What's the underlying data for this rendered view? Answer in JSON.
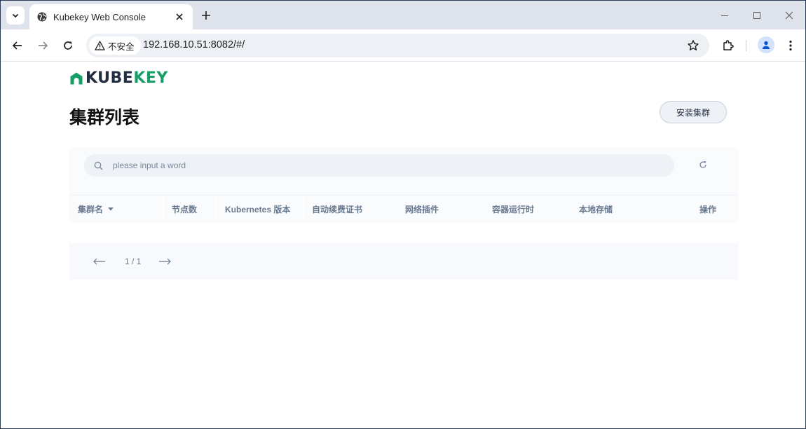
{
  "browser": {
    "tab_title": "Kubekey Web Console",
    "security_label": "不安全",
    "url": "192.168.10.51:8082/#/"
  },
  "app": {
    "logo_prefix": "KUBE",
    "logo_suffix": "KEY",
    "page_title": "集群列表",
    "install_button": "安装集群",
    "search_placeholder": "please input a word",
    "columns": [
      "集群名",
      "节点数",
      "Kubernetes 版本",
      "自动续费证书",
      "网络插件",
      "容器运行时",
      "本地存储",
      "操作"
    ],
    "pagination": "1 / 1"
  },
  "colors": {
    "brand_green": "#16a067",
    "text_dark": "#242e42",
    "muted": "#6a7a90"
  }
}
